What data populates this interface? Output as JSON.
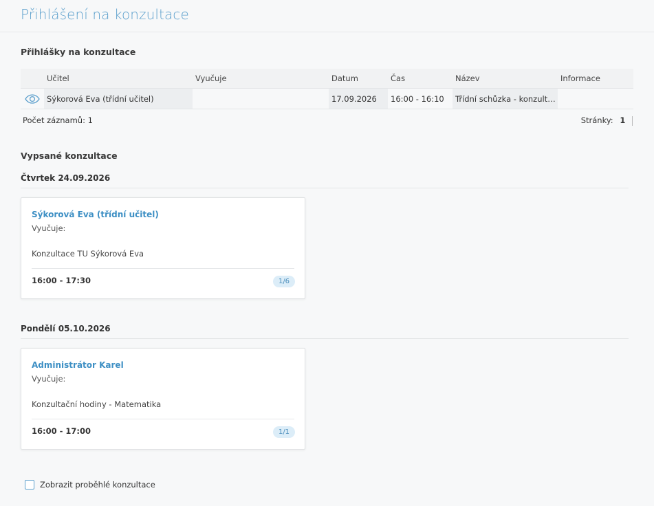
{
  "page": {
    "title": "Přihlášení na konzultace"
  },
  "registrations": {
    "title": "Přihlášky na konzultace",
    "columns": [
      "Učitel",
      "Vyučuje",
      "Datum",
      "Čas",
      "Název",
      "Informace"
    ],
    "rows": [
      {
        "icon": "eye-icon",
        "teacher": "Sýkorová Eva (třídní učitel)",
        "teaches": "",
        "date": "17.09.2026",
        "time": "16:00 - 16:10",
        "name": "Třídní schůzka - konzultace",
        "info": ""
      }
    ],
    "record_count_label": "Počet záznamů: 1",
    "pages_label": "Stránky:",
    "pages_value": "1"
  },
  "listed": {
    "title": "Vypsané konzultace",
    "days": [
      {
        "header": "Čtvrtek 24.09.2026",
        "cards": [
          {
            "teacher": "Sýkorová Eva (třídní učitel)",
            "teaches": "Vyučuje:",
            "description": "Konzultace TU Sýkorová Eva",
            "time": "16:00 - 17:30",
            "capacity": "1/6"
          }
        ]
      },
      {
        "header": "Pondělí 05.10.2026",
        "cards": [
          {
            "teacher": "Administrátor Karel",
            "teaches": "Vyučuje:",
            "description": "Konzultační hodiny - Matematika",
            "time": "16:00 - 17:00",
            "capacity": "1/1"
          }
        ]
      }
    ]
  },
  "show_past": {
    "label": "Zobrazit proběhlé konzultace",
    "checked": false
  },
  "colors": {
    "accent": "#5b9fcc",
    "link": "#3d8fc4",
    "badge_bg": "#dcedf8"
  }
}
